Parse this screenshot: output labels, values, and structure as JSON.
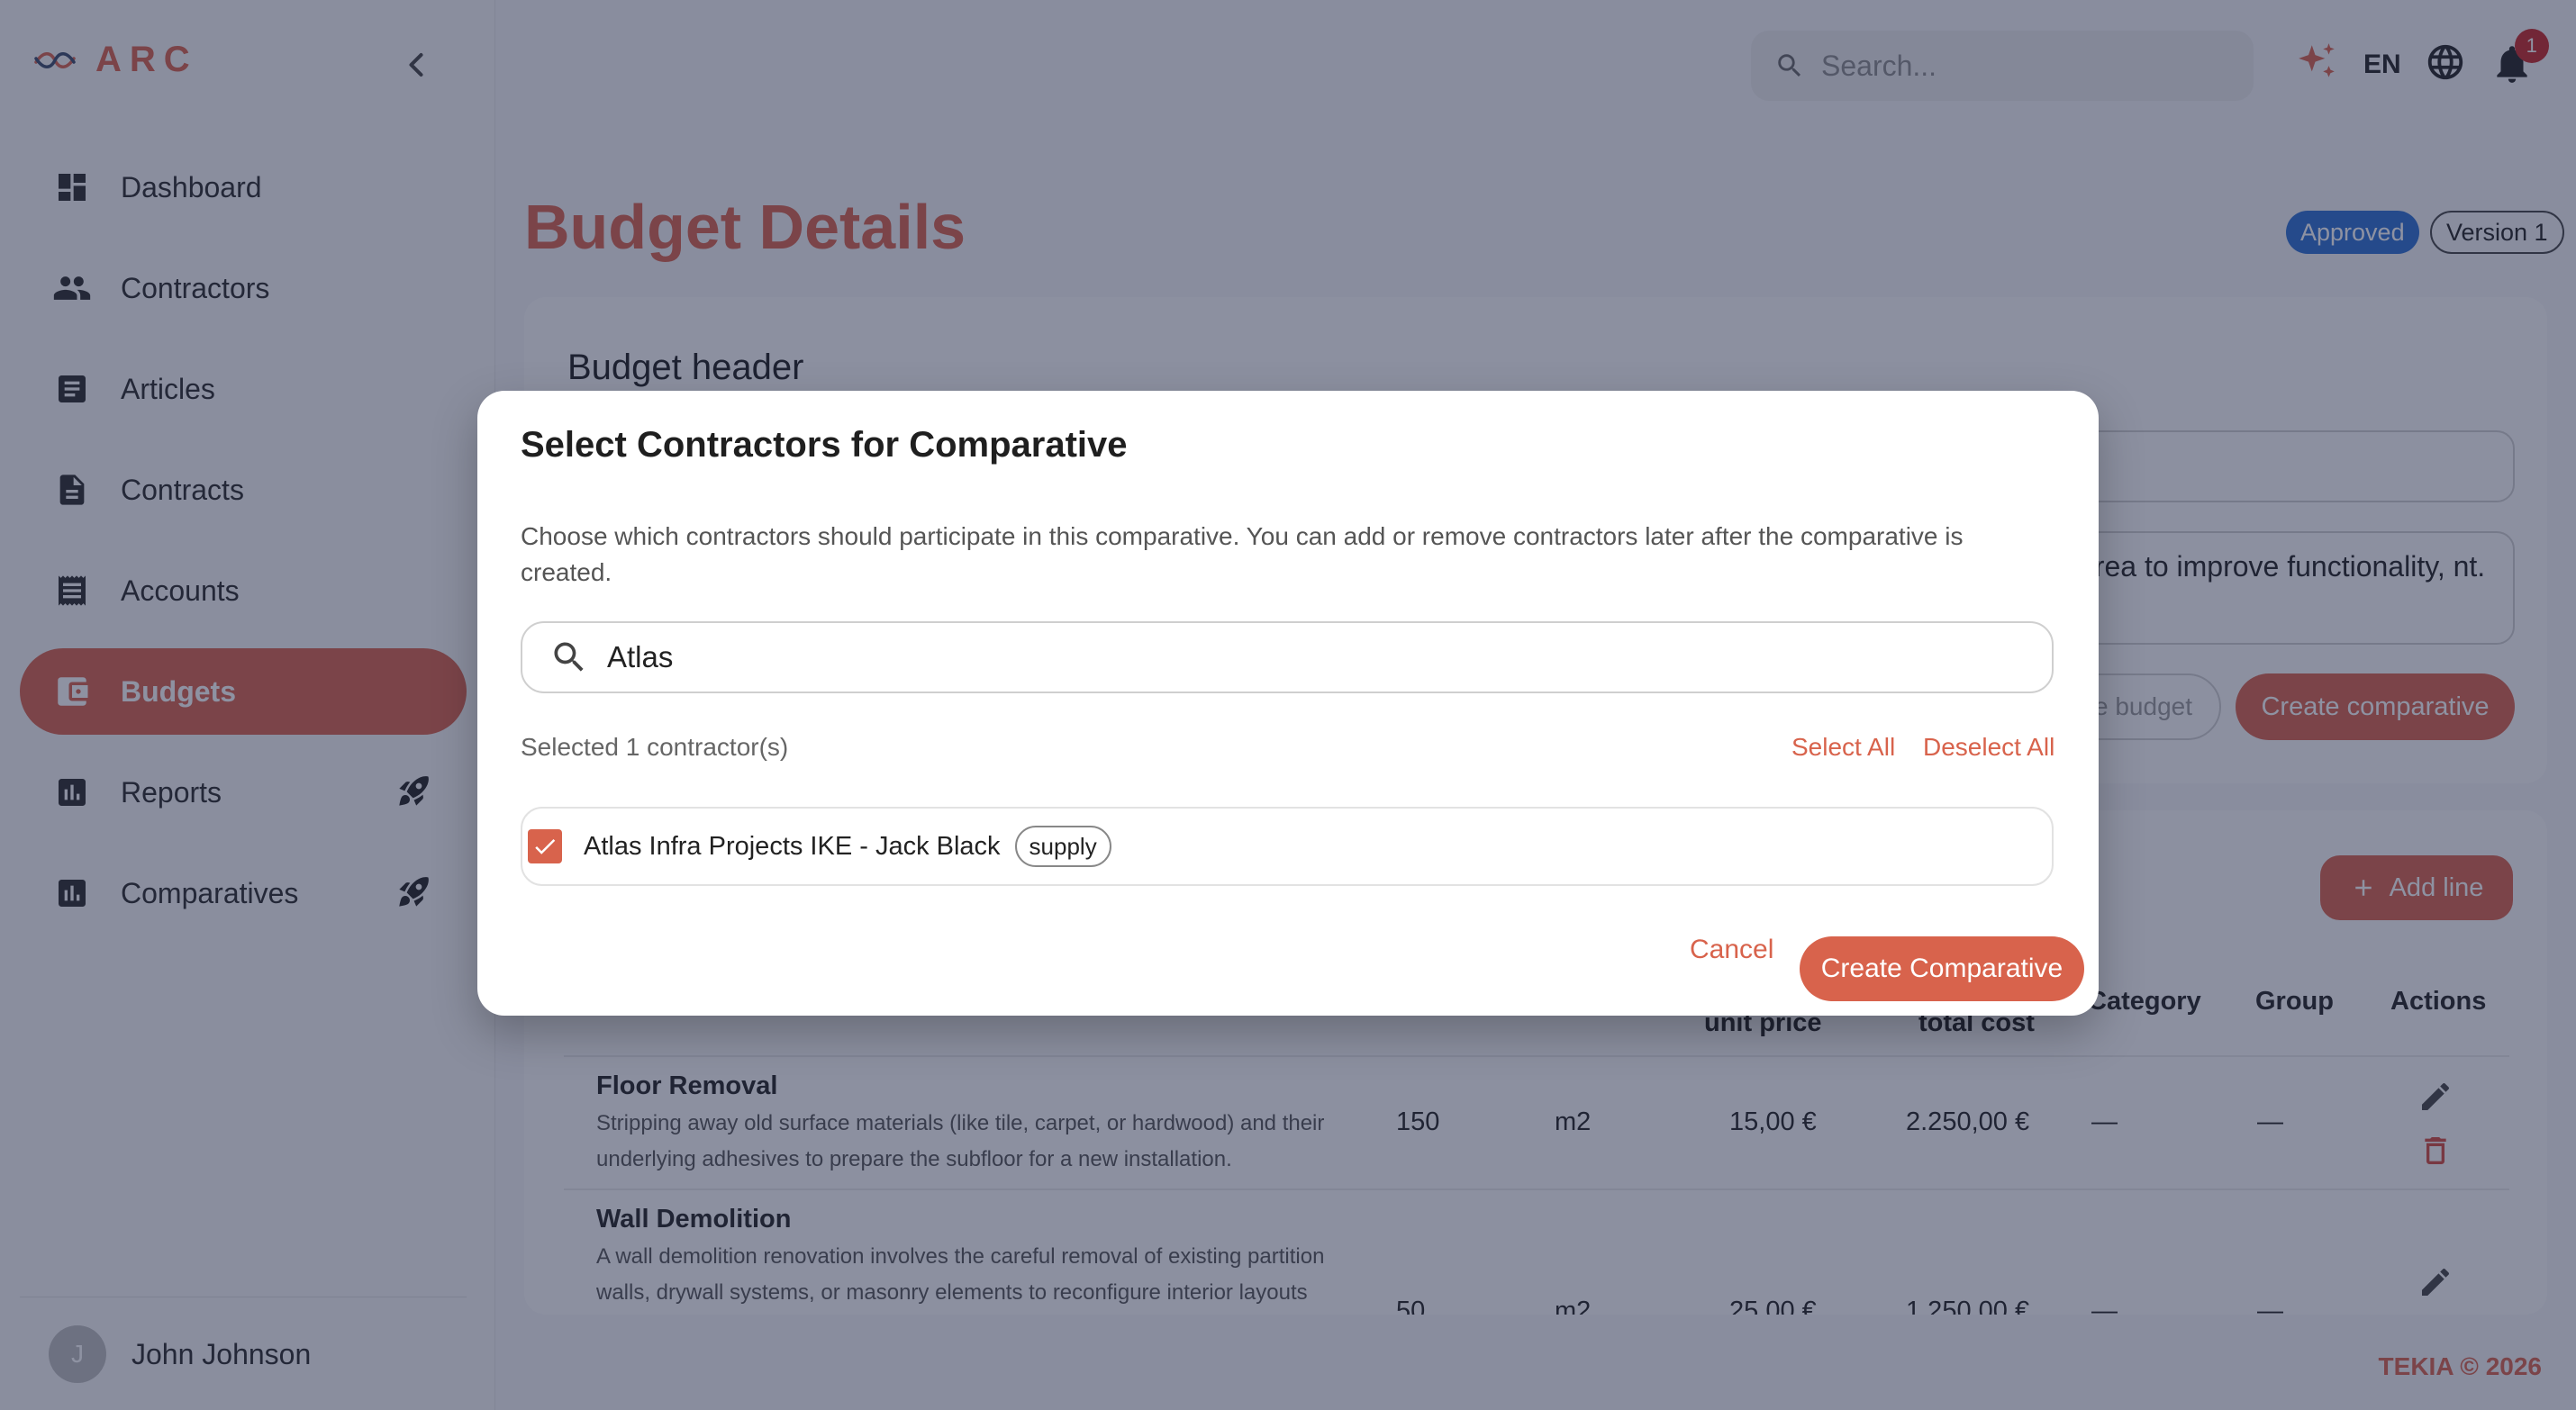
{
  "app": {
    "logo_text": "ARC"
  },
  "sidebar": {
    "items": [
      {
        "label": "Dashboard",
        "icon": "dashboard-icon"
      },
      {
        "label": "Contractors",
        "icon": "people-icon"
      },
      {
        "label": "Articles",
        "icon": "article-icon"
      },
      {
        "label": "Contracts",
        "icon": "document-icon"
      },
      {
        "label": "Accounts",
        "icon": "receipt-icon"
      },
      {
        "label": "Budgets",
        "icon": "wallet-icon",
        "active": true
      },
      {
        "label": "Reports",
        "icon": "bar-chart-icon",
        "badge_icon": "rocket-icon"
      },
      {
        "label": "Comparatives",
        "icon": "bar-chart-icon",
        "badge_icon": "rocket-icon"
      }
    ],
    "user": {
      "name": "John Johnson",
      "initial": "J"
    }
  },
  "topbar": {
    "search_placeholder": "Search...",
    "language": "EN",
    "notification_count": "1"
  },
  "page": {
    "title": "Budget Details",
    "status": "Approved",
    "version": "Version 1",
    "budget_header_title": "Budget header",
    "description_visible": "area to improve functionality, nt.",
    "btn_budget_partial": "e budget",
    "btn_create_comparative": "Create comparative",
    "btn_add_line": "Add line",
    "footer": "TEKIA © 2026"
  },
  "table": {
    "headers": {
      "unit_price": "unit price",
      "total_cost": "total cost",
      "category": "Category",
      "group": "Group",
      "actions": "Actions"
    },
    "rows": [
      {
        "title": "Floor Removal",
        "description": "Stripping away old surface materials (like tile, carpet, or hardwood) and their underlying adhesives to prepare the subfloor for a new installation.",
        "quantity": "150",
        "unit": "m2",
        "unit_price": "15,00 €",
        "total_cost": "2.250,00 €",
        "category": "—",
        "group": "—"
      },
      {
        "title": "Wall Demolition",
        "description": "A wall demolition renovation involves the careful removal of existing partition walls, drywall systems, or masonry elements to reconfigure interior layouts and improve spatial functionality. This process requires structural",
        "quantity": "50",
        "unit": "m2",
        "unit_price": "25,00 €",
        "total_cost": "1.250,00 €",
        "category": "—",
        "group": "—"
      }
    ]
  },
  "modal": {
    "title": "Select Contractors for Comparative",
    "description": "Choose which contractors should participate in this comparative. You can add or remove contractors later after the comparative is created.",
    "search_value": "Atlas",
    "selected_text": "Selected 1 contractor(s)",
    "select_all": "Select All",
    "deselect_all": "Deselect All",
    "contractors": [
      {
        "label": "Atlas Infra Projects IKE - Jack Black",
        "tag": "supply",
        "checked": true
      }
    ],
    "cancel": "Cancel",
    "create": "Create Comparative"
  },
  "colors": {
    "accent": "#d8634c",
    "status_blue": "#2d6fd0"
  }
}
